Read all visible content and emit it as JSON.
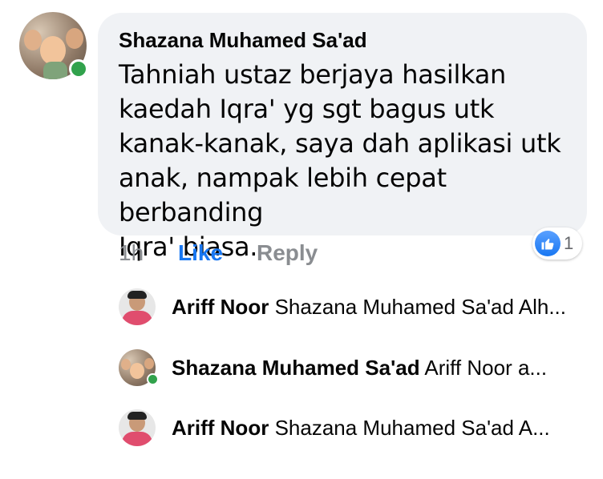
{
  "comment": {
    "author": "Shazana Muhamed Sa'ad",
    "text": "Tahniah ustaz berjaya hasilkan\nkaedah Iqra' yg sgt bagus utk\nkanak-kanak, saya dah aplikasi utk\nanak, nampak lebih cepat berbanding\nIqra' biasa.",
    "time": "1h",
    "like_label": "Like",
    "reply_label": "Reply",
    "reaction_count": "1",
    "reaction_icon": "thumbs-up-icon",
    "author_online": true
  },
  "replies": [
    {
      "author": "Ariff Noor",
      "preview": "Shazana Muhamed Sa'ad Alh..."
    },
    {
      "author": "Shazana Muhamed Sa'ad",
      "preview": "Ariff Noor a..."
    },
    {
      "author": "Ariff Noor",
      "preview": "Shazana Muhamed Sa'ad A..."
    }
  ],
  "colors": {
    "like": "#1877f2",
    "online": "#31a24c",
    "bubble": "#f0f2f5",
    "muted": "#8a8d91"
  }
}
